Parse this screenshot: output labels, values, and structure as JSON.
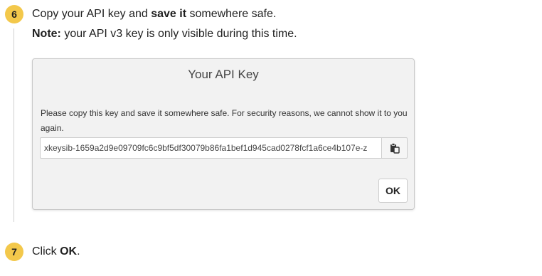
{
  "step6": {
    "number": "6",
    "line1_prefix": "Copy your API key and ",
    "line1_bold": "save it",
    "line1_suffix": " somewhere safe.",
    "line2_bold": "Note:",
    "line2_rest": " your API v3 key is only visible during this time."
  },
  "dialog": {
    "title": "Your API Key",
    "message": "Please copy this key and save it somewhere safe. For security reasons, we cannot show it to you again.",
    "key_value": "xkeysib-1659a2d9e09709fc6c9bf5df30079b86fa1bef1d945cad0278fcf1a6ce4b107e-z",
    "copy_icon": "clipboard-copy-icon",
    "ok_label": "OK"
  },
  "step7": {
    "number": "7",
    "prefix": "Click ",
    "bold": "OK",
    "suffix": "."
  },
  "colors": {
    "badge": "#f3c84b",
    "dialog_bg": "#f2f2f2",
    "border": "#c9c9c9"
  }
}
